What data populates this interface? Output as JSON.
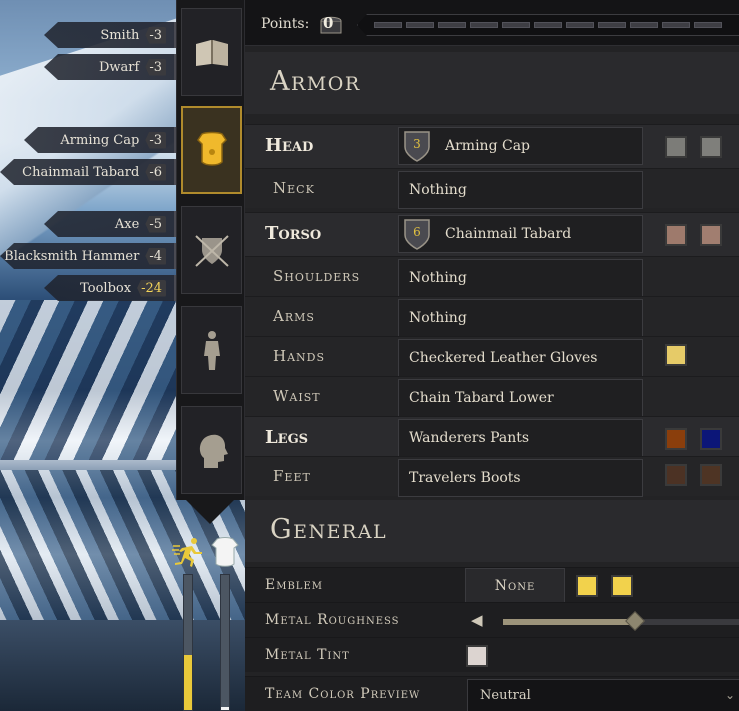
{
  "points": {
    "label": "Points:",
    "value": "0"
  },
  "cost_tags": [
    {
      "name": "Smith",
      "cost": "-3",
      "highlight": false
    },
    {
      "name": "Dwarf",
      "cost": "-3",
      "highlight": false
    },
    {
      "name": "Arming Cap",
      "cost": "-3",
      "highlight": false
    },
    {
      "name": "Chainmail Tabard",
      "cost": "-6",
      "highlight": false
    },
    {
      "name": "Axe",
      "cost": "-5",
      "highlight": false
    },
    {
      "name": "Blacksmith Hammer",
      "cost": "-4",
      "highlight": false
    },
    {
      "name": "Toolbox",
      "cost": "-24",
      "highlight": true
    }
  ],
  "tabs": [
    {
      "id": "book",
      "icon": "book-icon",
      "active": false
    },
    {
      "id": "armor",
      "icon": "armor-icon",
      "active": true
    },
    {
      "id": "weapons",
      "icon": "shield-swords-icon",
      "active": false
    },
    {
      "id": "body",
      "icon": "body-figure-icon",
      "active": false
    },
    {
      "id": "head",
      "icon": "head-profile-icon",
      "active": false
    }
  ],
  "status_icons": [
    "running-figure-icon",
    "armor-weight-icon"
  ],
  "stamina_bars": [
    {
      "name": "run-stamina",
      "level": 0.41
    },
    {
      "name": "armor-weight",
      "level": 0.02
    }
  ],
  "armor": {
    "title": "Armor",
    "rows": [
      {
        "slot": "Head",
        "type": "main",
        "item": "Arming Cap",
        "tier": "3",
        "swatches": [
          "#7c7c78",
          "#7f7f7b"
        ]
      },
      {
        "slot": "Neck",
        "type": "sub",
        "item": "Nothing",
        "tier": "",
        "swatches": []
      },
      {
        "slot": "Torso",
        "type": "main",
        "item": "Chainmail Tabard",
        "tier": "6",
        "swatches": [
          "#9e7a6c",
          "#a17e70"
        ]
      },
      {
        "slot": "Shoulders",
        "type": "sub",
        "item": "Nothing",
        "tier": "",
        "swatches": []
      },
      {
        "slot": "Arms",
        "type": "sub",
        "item": "Nothing",
        "tier": "",
        "swatches": []
      },
      {
        "slot": "Hands",
        "type": "sub",
        "item": "Checkered Leather Gloves",
        "tier": "",
        "swatches": [
          "#e6cb68"
        ]
      },
      {
        "slot": "Waist",
        "type": "sub",
        "item": "Chain Tabard Lower",
        "tier": "",
        "swatches": []
      },
      {
        "slot": "Legs",
        "type": "main",
        "item": "Wanderers Pants",
        "tier": "",
        "swatches": [
          "#8a3e0c",
          "#0c1678"
        ]
      },
      {
        "slot": "Feet",
        "type": "sub",
        "item": "Travelers Boots",
        "tier": "",
        "swatches": [
          "#4c3224",
          "#4e3424"
        ]
      }
    ]
  },
  "general": {
    "title": "General",
    "emblem": {
      "label": "Emblem",
      "value": "None",
      "swatches": [
        "#f2d24c",
        "#f2d24c"
      ]
    },
    "metal_roughness": {
      "label": "Metal Roughness",
      "level": 0.56
    },
    "metal_tint": {
      "label": "Metal Tint",
      "swatch": "#dcd4d0"
    },
    "team_color": {
      "label": "Team Color Preview",
      "value": "Neutral"
    }
  }
}
